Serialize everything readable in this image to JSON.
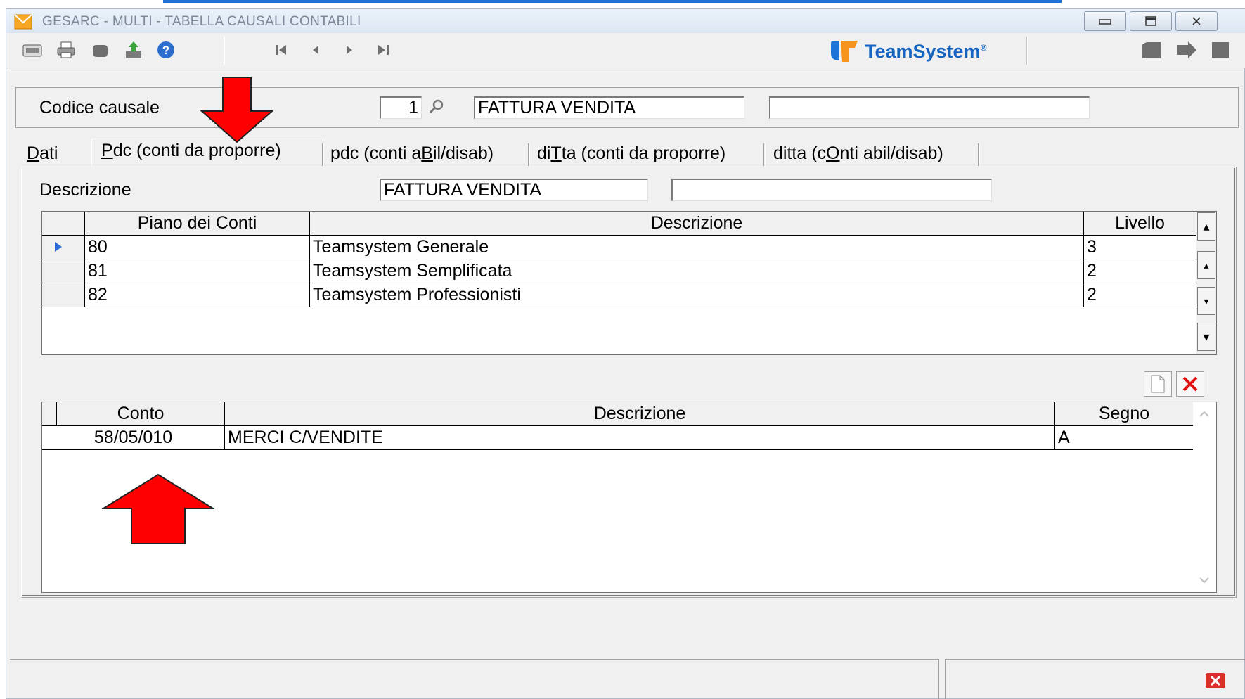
{
  "window": {
    "title": "GESARC  - MULTI -  TABELLA CAUSALI CONTABILI"
  },
  "toolbar": {
    "brand": "TeamSystem",
    "brand_mark": "®"
  },
  "header": {
    "codice_label": "Codice causale",
    "codice_value": "1",
    "descrizione_value": "FATTURA VENDITA",
    "extra_value": ""
  },
  "tabs": [
    {
      "pre": "",
      "u": "D",
      "post": "ati"
    },
    {
      "pre": "",
      "u": "P",
      "post": "dc (conti da proporre)"
    },
    {
      "pre": "pdc (conti a",
      "u": "B",
      "post": "il/disab)"
    },
    {
      "pre": "di",
      "u": "T",
      "post": "ta (conti da proporre)"
    },
    {
      "pre": "ditta (c",
      "u": "O",
      "post": "nti abil/disab)"
    }
  ],
  "tab_content": {
    "descrizione_label": "Descrizione",
    "descrizione_value": "FATTURA VENDITA",
    "descrizione_extra": ""
  },
  "grid_pdc": {
    "headers": [
      "Piano dei Conti",
      "Descrizione",
      "Livello"
    ],
    "rows": [
      {
        "piano": "80",
        "descrizione": "Teamsystem Generale",
        "livello": "3"
      },
      {
        "piano": "81",
        "descrizione": "Teamsystem Semplificata",
        "livello": "2"
      },
      {
        "piano": "82",
        "descrizione": "Teamsystem Professionisti",
        "livello": "2"
      }
    ]
  },
  "grid_conti": {
    "headers": [
      "Conto",
      "Descrizione",
      "Segno"
    ],
    "rows": [
      {
        "conto": "58/05/010",
        "descrizione": "MERCI C/VENDITE",
        "segno": "A"
      }
    ]
  },
  "colors": {
    "arrow": "#ff0000",
    "brand_blue": "#1565c0",
    "accent_line": "#1f6fd6"
  }
}
